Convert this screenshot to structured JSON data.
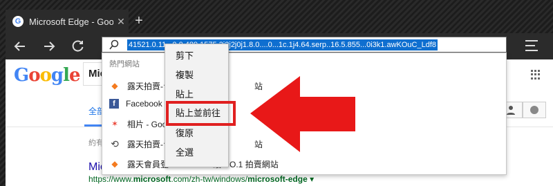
{
  "browser": {
    "tab_title": "Microsoft Edge - Googl",
    "tab_close": "✕",
    "new_tab": "+",
    "favicon": "G",
    "address_text": "41521.0.11...0.0.489.1575.3j2j2j0j1.8.0....0...1c.1j4.64.serp..16.5.855...0i3k1.awKOuC_Ldf8",
    "icons": [
      "back-icon",
      "forward-icon",
      "refresh-icon",
      "search-icon",
      "menu-icon"
    ]
  },
  "suggestions": {
    "header": "熱門網站",
    "items": [
      {
        "icon": "ruten-icon",
        "label": "露天拍賣-台",
        "trail": "站"
      },
      {
        "icon": "facebook-icon",
        "label": "Facebook",
        "trail": ""
      },
      {
        "icon": "photos-icon",
        "label": "相片 - Goog",
        "trail": ""
      },
      {
        "icon": "history-icon",
        "label": "露天拍賣-台",
        "trail": "站"
      },
      {
        "icon": "ruten-icon",
        "label": "露天會員登",
        "trail": "最 NO.1 拍賣網站"
      }
    ]
  },
  "context_menu": {
    "items": [
      "剪下",
      "複製",
      "貼上",
      "貼上並前往",
      "復原",
      "全選"
    ],
    "highlighted": "貼上並前往"
  },
  "page": {
    "logo": "Google",
    "search_prefix": "Mic",
    "tab_all": "全部",
    "result_count": "約有",
    "result_title": "Mic",
    "result_url_prefix": "https://www.",
    "result_url_bold": "microsoft",
    "result_url_mid": ".com/zh-tw/windows/",
    "result_url_bold2": "microsoft-edge",
    "result_url_end": " ▾"
  },
  "colors": {
    "annotation_red": "#e02020",
    "address_highlight": "#0f6fd0"
  }
}
